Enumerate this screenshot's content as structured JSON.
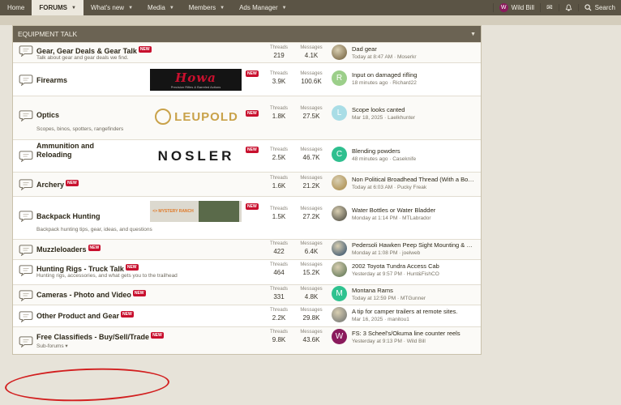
{
  "nav": {
    "items": [
      {
        "label": "Home"
      },
      {
        "label": "FORUMS",
        "active": true
      },
      {
        "label": "What's new"
      },
      {
        "label": "Media"
      },
      {
        "label": "Members"
      },
      {
        "label": "Ads Manager"
      }
    ],
    "user": {
      "name": "Wild Bill",
      "initial": "W"
    },
    "search_label": "Search"
  },
  "section": {
    "title": "EQUIPMENT TALK"
  },
  "labels": {
    "threads": "Threads",
    "messages": "Messages",
    "new_badge": "NEW"
  },
  "forums": [
    {
      "title": "Gear, Gear Deals & Gear Talk",
      "new": true,
      "desc": "Talk about gear and gear deals we find.",
      "threads": "219",
      "messages": "4.1K",
      "last": {
        "title": "Dad gear",
        "time": "Today at 8:47 AM",
        "user": "Moserkr",
        "avatar": "photo",
        "color": "#8b7b5a"
      }
    },
    {
      "title": "Firearms",
      "new": true,
      "desc": "",
      "logo": {
        "text": "Howa",
        "tagline": "Precision Rifles & Barreled Actions"
      },
      "threads": "3.9K",
      "messages": "100.6K",
      "last": {
        "title": "Input on damaged rifling",
        "time": "18 minutes ago",
        "user": "Richard22",
        "avatar": "R",
        "color": "#9ccf8a"
      }
    },
    {
      "title": "Optics",
      "new": true,
      "desc": "Scopes, binos, spotters, rangefinders",
      "logo": {
        "text": "LEUPOLD"
      },
      "threads": "1.8K",
      "messages": "27.5K",
      "last": {
        "title": "Scope looks canted",
        "time": "Mar 18, 2025",
        "user": "Laelkhunter",
        "avatar": "L",
        "color": "#a9dde6"
      }
    },
    {
      "title": "Ammunition and Reloading",
      "new": true,
      "desc": "",
      "logo": {
        "text": "NOSLER"
      },
      "threads": "2.5K",
      "messages": "46.7K",
      "last": {
        "title": "Blending powders",
        "time": "48 minutes ago",
        "user": "Caseknife",
        "avatar": "C",
        "color": "#2fbf8f"
      }
    },
    {
      "title": "Archery",
      "new": true,
      "desc": "",
      "threads": "1.6K",
      "messages": "21.2K",
      "last": {
        "title": "Non Political Broadhead Thread (With a Bonus ...",
        "time": "Today at 6:03 AM",
        "user": "Pucky Freak",
        "avatar": "photo",
        "color": "#b59b63"
      }
    },
    {
      "title": "Backpack Hunting",
      "new": true,
      "desc": "Backpack hunting tips, gear, ideas, and questions",
      "logo": {
        "text": "MYSTERY RANCH"
      },
      "threads": "1.5K",
      "messages": "27.2K",
      "last": {
        "title": "Water Bottles or Water Bladder",
        "time": "Monday at 1:14 PM",
        "user": "MTLabrador",
        "avatar": "photo",
        "color": "#6d6a5c"
      }
    },
    {
      "title": "Muzzleloaders",
      "new": true,
      "desc": "",
      "threads": "422",
      "messages": "6.4K",
      "last": {
        "title": "Pedersoli Hawken Peep Sight Mounting & Comp...",
        "time": "Monday at 1:08 PM",
        "user": "joelweb",
        "avatar": "photo",
        "color": "#5a6e7d"
      }
    },
    {
      "title": "Hunting Rigs - Truck Talk",
      "new": true,
      "desc": "Hunting rigs, accessories, and what gets you to the trailhead",
      "threads": "464",
      "messages": "15.2K",
      "last": {
        "title": "2002 Toyota Tundra Access Cab",
        "time": "Yesterday at 9:57 PM",
        "user": "Hunt&FishCO",
        "avatar": "photo",
        "color": "#7a8a6a"
      }
    },
    {
      "title": "Cameras - Photo and Video",
      "new": true,
      "desc": "",
      "threads": "331",
      "messages": "4.8K",
      "last": {
        "title": "Montana Rams",
        "time": "Today at 12:59 PM",
        "user": "MTGunner",
        "avatar": "M",
        "color": "#2fc28f"
      }
    },
    {
      "title": "Other Product and Gear",
      "new": true,
      "desc": "",
      "threads": "2.2K",
      "messages": "29.8K",
      "last": {
        "title": "A tip for camper trailers at remote sites.",
        "time": "Mar 16, 2025",
        "user": "manitou1",
        "avatar": "photo",
        "color": "#8a8a82"
      }
    },
    {
      "title": "Free Classifieds - Buy/Sell/Trade",
      "new": true,
      "desc": "",
      "subforums": "Sub-forums",
      "threads": "9.8K",
      "messages": "43.6K",
      "last": {
        "title": "FS: 3 Scheel's/Okuma line counter reels",
        "time": "Yesterday at 9:13 PM",
        "user": "Wild Bill",
        "avatar": "W",
        "color": "#8a1a5c"
      }
    }
  ]
}
